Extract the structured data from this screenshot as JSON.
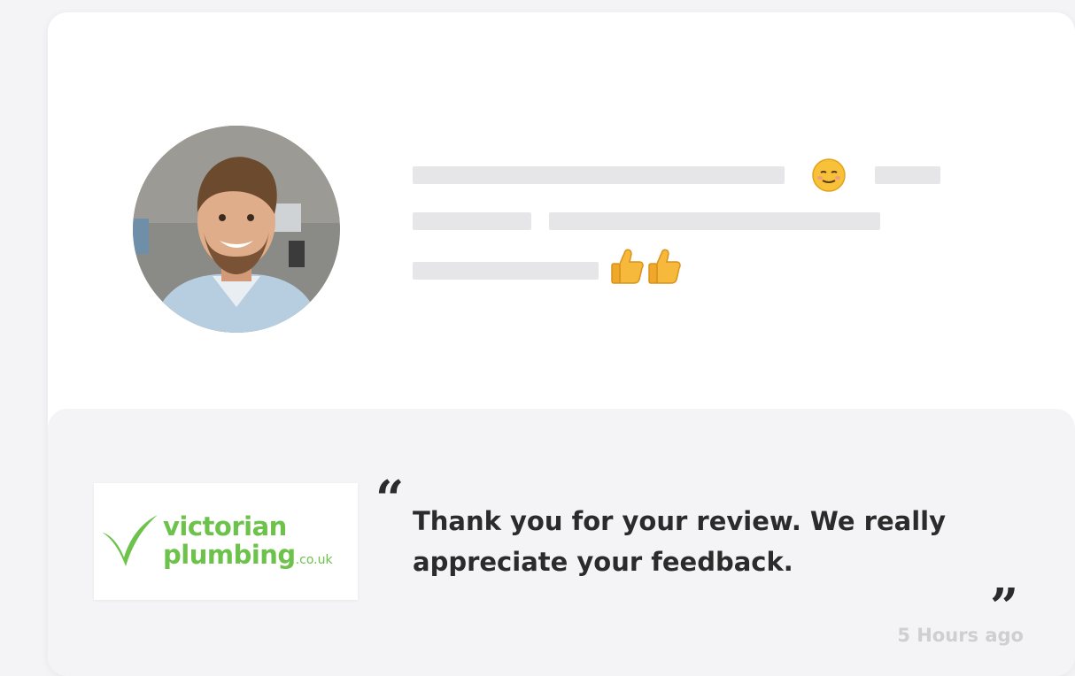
{
  "review": {
    "avatar": "avatar-photo",
    "emojis": [
      "smiling-face-emoji",
      "thumbs-up-emoji",
      "thumbs-up-emoji"
    ]
  },
  "reply": {
    "logo": {
      "line1": "victorian",
      "line2": "plumbing",
      "domain": ".co.uk",
      "brand_color": "#6cc24a"
    },
    "open_quote": "“",
    "message": "Thank you for your review. We really appreciate your feedback.",
    "close_quote": "”",
    "timestamp": "5 Hours ago"
  },
  "colors": {
    "card_bg": "#ffffff",
    "reply_bg": "#f4f4f6",
    "skeleton_bar": "#e6e6e8",
    "text": "#2b2b2b",
    "muted": "#cfcfd3"
  }
}
